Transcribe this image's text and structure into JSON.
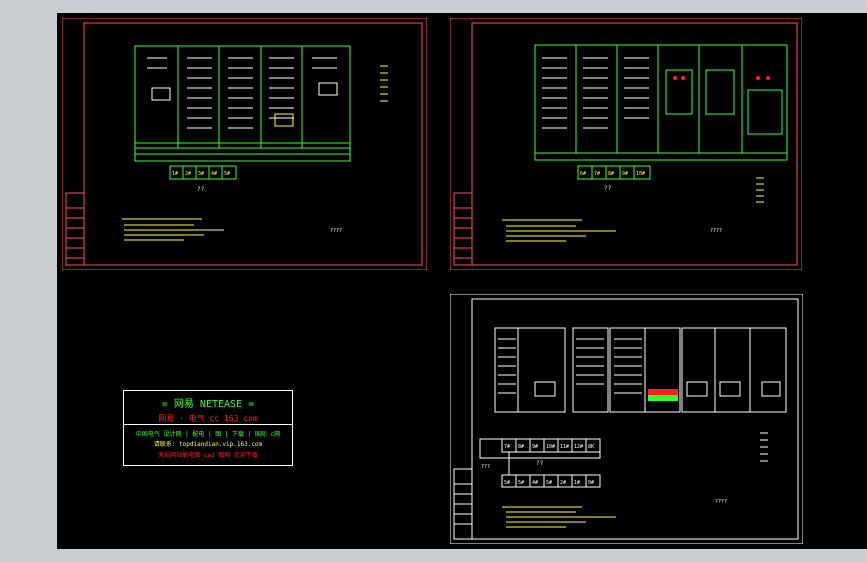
{
  "sheet1": {
    "tiles": [
      "1#",
      "2#",
      "3#",
      "4#",
      "5#"
    ],
    "question": "??",
    "caption": "????"
  },
  "sheet2": {
    "tiles": [
      "6#",
      "7#",
      "8#",
      "9#",
      "10#"
    ],
    "question": "??",
    "caption": "????"
  },
  "sheet3": {
    "upper_tiles": [
      "7#",
      "8#",
      "9#",
      "10#",
      "11#",
      "12#",
      "8K"
    ],
    "lower_tiles": [
      "5#",
      "5#",
      "4#",
      "5#",
      "2#",
      "1#",
      "0#"
    ],
    "left_label": "???",
    "question": "??",
    "caption": "????"
  },
  "logo": {
    "title": "= 网易 NETEASE =",
    "line1": "网易 · 电气     cc 163 com",
    "line2": "中国电气 设计网 | 配电 | 图 | 下载 | 国际 c网",
    "line3": "请联系: topdiandian.vip.163.com",
    "line4": "无损网站配电图 cad 图网 欢迎下载"
  },
  "colors": {
    "frame_red": "#ff5050",
    "wire_green": "#33ff33",
    "text_yellow": "#ffff33",
    "text_white": "#ffffff",
    "accent_red": "#ff2020"
  }
}
